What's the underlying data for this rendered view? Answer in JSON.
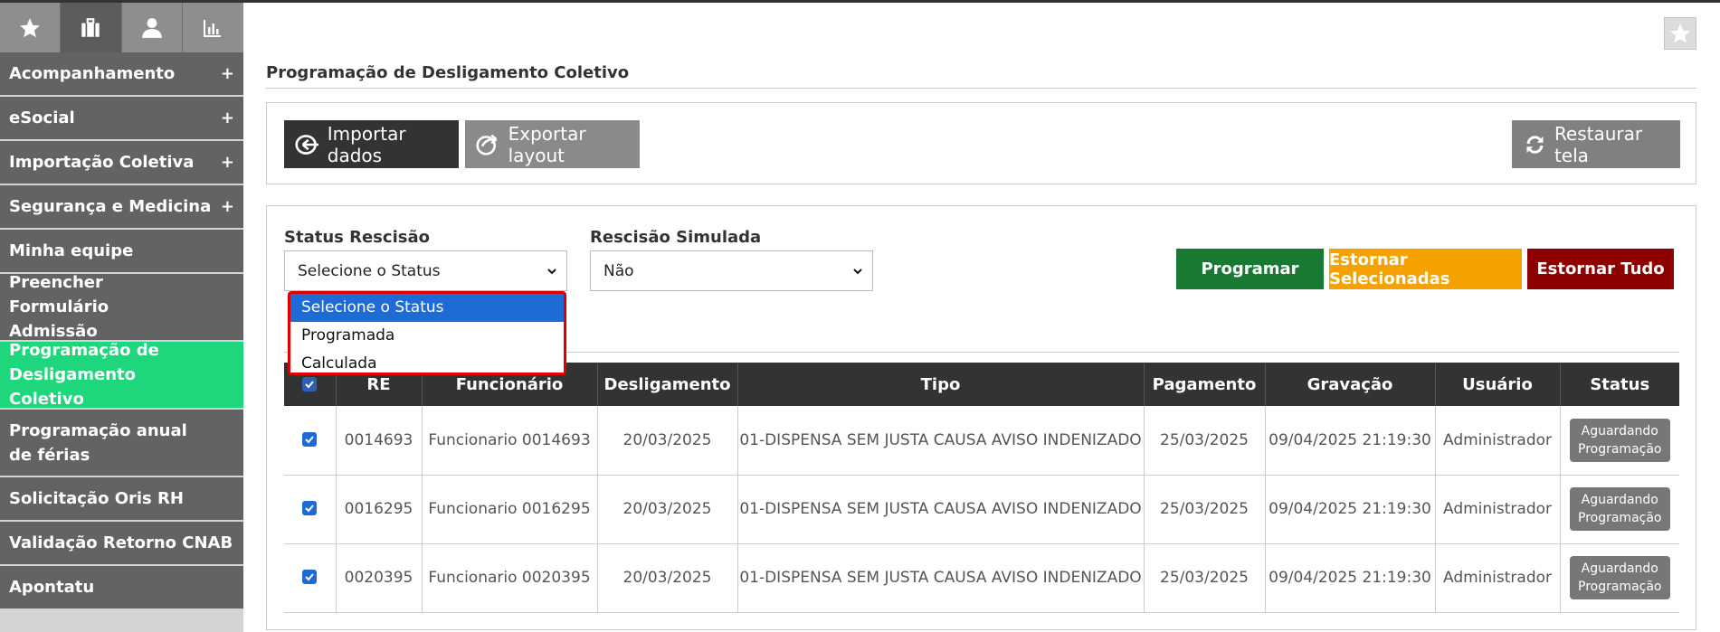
{
  "sidebar": {
    "top_icons": [
      {
        "icon": "star-icon"
      },
      {
        "icon": "briefcase-icon"
      },
      {
        "icon": "user-icon"
      },
      {
        "icon": "bar-chart-icon"
      }
    ],
    "items": [
      {
        "label": "Acompanhamento",
        "plus": "+"
      },
      {
        "label": "eSocial",
        "plus": "+"
      },
      {
        "label": "Importação Coletiva",
        "plus": "+"
      },
      {
        "label": "Segurança e Medicina",
        "plus": "+"
      },
      {
        "label": "Minha equipe"
      },
      {
        "label": "Preencher Formulário Admissão"
      },
      {
        "label": "Programação de Desligamento Coletivo"
      },
      {
        "label": "Programação anual de férias"
      },
      {
        "label": "Solicitação Oris RH"
      },
      {
        "label": "Validação Retorno CNAB"
      },
      {
        "label": "Apontatu"
      }
    ]
  },
  "page": {
    "title": "Programação de Desligamento Coletivo"
  },
  "toolbar": {
    "import_label": "Importar dados",
    "export_label": "Exportar layout",
    "restore_label": "Restaurar tela"
  },
  "filters": {
    "status_label": "Status Rescisão",
    "status_value": "Selecione o Status",
    "status_options": [
      "Selecione o Status",
      "Programada",
      "Calculada"
    ],
    "simulated_label": "Rescisão Simulada",
    "simulated_value": "Não"
  },
  "actions": {
    "program": "Programar",
    "reverse_selected": "Estornar Selecionadas",
    "reverse_all": "Estornar Tudo"
  },
  "colors": {
    "active_menu": "#1ed67b",
    "program": "#187a32",
    "reverse_selected": "#f5a100",
    "reverse_all": "#8f0000",
    "dropdown_highlight": "#1f6bd6"
  },
  "table": {
    "headers": [
      "RE",
      "Funcionário",
      "Desligamento",
      "Tipo",
      "Pagamento",
      "Gravação",
      "Usuário",
      "Status"
    ],
    "rows": [
      {
        "re": "0014693",
        "funcionario": "Funcionario 0014693",
        "desligamento": "20/03/2025",
        "tipo": "01-DISPENSA SEM JUSTA CAUSA AVISO INDENIZADO",
        "pagamento": "25/03/2025",
        "gravacao": "09/04/2025 21:19:30",
        "usuario": "Administrador",
        "status_l1": "Aguardando",
        "status_l2": "Programação"
      },
      {
        "re": "0016295",
        "funcionario": "Funcionario 0016295",
        "desligamento": "20/03/2025",
        "tipo": "01-DISPENSA SEM JUSTA CAUSA AVISO INDENIZADO",
        "pagamento": "25/03/2025",
        "gravacao": "09/04/2025 21:19:30",
        "usuario": "Administrador",
        "status_l1": "Aguardando",
        "status_l2": "Programação"
      },
      {
        "re": "0020395",
        "funcionario": "Funcionario 0020395",
        "desligamento": "20/03/2025",
        "tipo": "01-DISPENSA SEM JUSTA CAUSA AVISO INDENIZADO",
        "pagamento": "25/03/2025",
        "gravacao": "09/04/2025 21:19:30",
        "usuario": "Administrador",
        "status_l1": "Aguardando",
        "status_l2": "Programação"
      }
    ]
  }
}
